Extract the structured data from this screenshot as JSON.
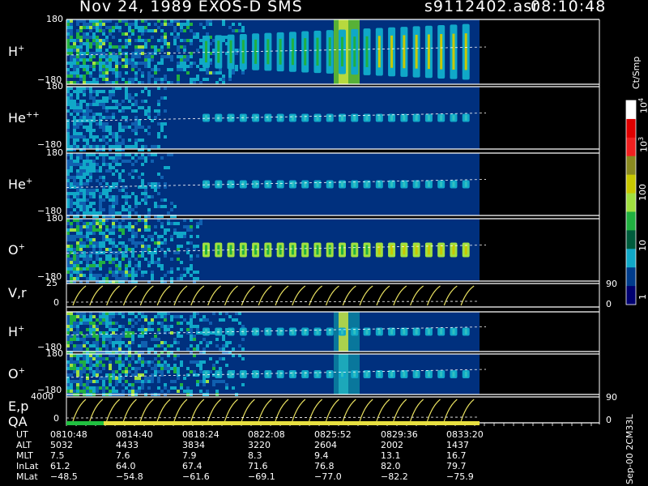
{
  "header": {
    "title": "Nov 24, 1989    EXOS-D SMS",
    "file": "s9112402.asr",
    "time": "08:10:48"
  },
  "panels": [
    {
      "label": "H",
      "sup": "+",
      "ymax": "180",
      "ymin": "−180",
      "kind": "ion"
    },
    {
      "label": "He",
      "sup": "++",
      "ymax": "180",
      "ymin": "−180",
      "kind": "ion"
    },
    {
      "label": "He",
      "sup": "+",
      "ymax": "180",
      "ymin": "−180",
      "kind": "ion"
    },
    {
      "label": "O",
      "sup": "+",
      "ymax": "180",
      "ymin": "−180",
      "kind": "ion"
    },
    {
      "label": "V,r",
      "sup": "",
      "ymax": "25",
      "ymin": "0",
      "kind": "line",
      "right_top": "90",
      "right_bottom": "0"
    },
    {
      "label": "H",
      "sup": "+",
      "ymax": "",
      "ymin": "−180",
      "kind": "ion2"
    },
    {
      "label": "O",
      "sup": "+",
      "ymax": "180",
      "ymin": "−180",
      "kind": "ion2"
    },
    {
      "label": "E,p",
      "sup": "",
      "ymax": "4000",
      "ymin": "0",
      "kind": "line",
      "right_top": "90",
      "right_bottom": "0"
    }
  ],
  "qa_label": "QA",
  "colorbar": {
    "title": "Ct/Smp",
    "ticks": [
      "10",
      "10",
      "100",
      "10",
      "1"
    ],
    "tick_sups": [
      "4",
      "3",
      "",
      "",
      ""
    ],
    "colors": [
      "#ffffff",
      "#e00000",
      "#f02020",
      "#8a8a20",
      "#c8c800",
      "#a0e040",
      "#20b040",
      "#005c3c",
      "#10a8c8",
      "#003c8c",
      "#000070"
    ]
  },
  "colorbar_note": "Sep-00  2CM33L",
  "orbit": {
    "labels": [
      "UT",
      "ALT",
      "MLT",
      "InLat",
      "MLat"
    ],
    "rows": [
      [
        "0810:48",
        "0814:40",
        "0818:24",
        "0822:08",
        "0825:52",
        "0829:36",
        "0833:20"
      ],
      [
        "5032",
        "4433",
        "3834",
        "3220",
        "2604",
        "2002",
        "1437"
      ],
      [
        "7.5",
        "7.6",
        "7.9",
        "8.3",
        "9.4",
        "13.1",
        "16.7"
      ],
      [
        "61.2",
        "64.0",
        "67.4",
        "71.6",
        "76.8",
        "82.0",
        "79.7"
      ],
      [
        "−48.5",
        "−54.8",
        "−61.6",
        "−69.1",
        "−77.0",
        "−82.2",
        "−75.9"
      ]
    ]
  },
  "chart_data": {
    "type": "heatmap",
    "title": "Nov 24, 1989    EXOS-D SMS",
    "x": [
      "0810:48",
      "0814:40",
      "0818:24",
      "0822:08",
      "0825:52",
      "0829:36",
      "0833:20"
    ],
    "xlabel": "UT",
    "series": [
      {
        "name": "H+",
        "ylim": [
          -180,
          180
        ]
      },
      {
        "name": "He++",
        "ylim": [
          -180,
          180
        ]
      },
      {
        "name": "He+",
        "ylim": [
          -180,
          180
        ]
      },
      {
        "name": "O+",
        "ylim": [
          -180,
          180
        ]
      },
      {
        "name": "V,r",
        "ylim": [
          0,
          25
        ]
      },
      {
        "name": "H+",
        "ylim": [
          -180,
          180
        ]
      },
      {
        "name": "O+",
        "ylim": [
          -180,
          180
        ]
      },
      {
        "name": "E,p",
        "ylim": [
          0,
          4000
        ]
      }
    ],
    "colorbar_units": "Ct/Smp",
    "colorbar_range": [
      1,
      10000
    ],
    "colorbar_scale": "log"
  }
}
